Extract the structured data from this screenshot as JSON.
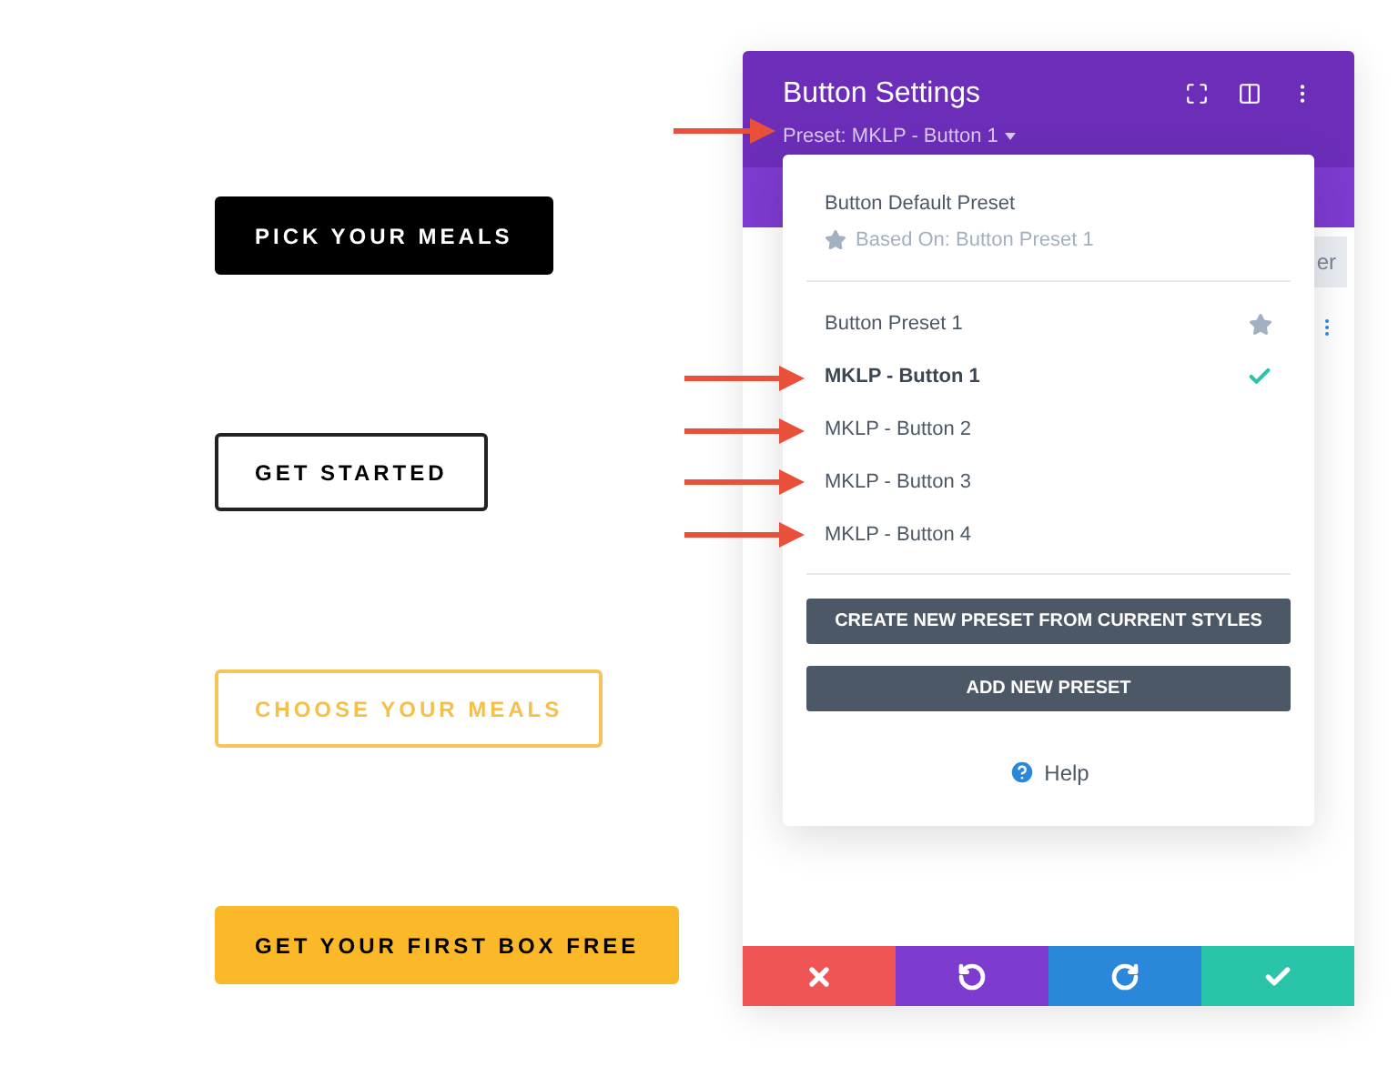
{
  "sample_buttons": [
    {
      "label": "PICK YOUR MEALS",
      "kind": "solid-dark"
    },
    {
      "label": "GET STARTED",
      "kind": "outline-dark"
    },
    {
      "label": "CHOOSE YOUR MEALS",
      "kind": "outline-yellow"
    },
    {
      "label": "GET YOUR FIRST BOX FREE",
      "kind": "solid-yellow"
    }
  ],
  "panel": {
    "title": "Button Settings",
    "preset_label": "Preset: MKLP - Button 1",
    "preset_arrow": true,
    "tab_fragment": "er",
    "dropdown": {
      "default_preset": "Button Default Preset",
      "based_on": "Based On: Button Preset 1",
      "presets": [
        {
          "label": "Button Preset 1",
          "starred": true,
          "selected": false,
          "arrow": false
        },
        {
          "label": "MKLP - Button 1",
          "starred": false,
          "selected": true,
          "arrow": true
        },
        {
          "label": "MKLP - Button 2",
          "starred": false,
          "selected": false,
          "arrow": true
        },
        {
          "label": "MKLP - Button 3",
          "starred": false,
          "selected": false,
          "arrow": true
        },
        {
          "label": "MKLP - Button 4",
          "starred": false,
          "selected": false,
          "arrow": true
        }
      ],
      "actions": [
        "CREATE NEW PRESET FROM CURRENT STYLES",
        "ADD NEW PRESET"
      ],
      "help": "Help"
    },
    "footer": [
      {
        "kind": "cancel"
      },
      {
        "kind": "undo"
      },
      {
        "kind": "redo"
      },
      {
        "kind": "save"
      }
    ]
  }
}
